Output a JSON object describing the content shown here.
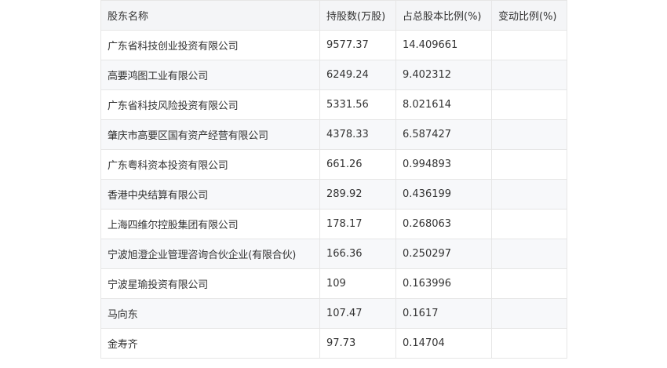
{
  "table": {
    "headers": [
      "股东名称",
      "持股数(万股)",
      "占总股本比例(%)",
      "变动比例(%)"
    ],
    "rows": [
      {
        "name": "广东省科技创业投资有限公司",
        "shares": "9577.37",
        "ratio": "14.409661",
        "change": ""
      },
      {
        "name": "高要鸿图工业有限公司",
        "shares": "6249.24",
        "ratio": "9.402312",
        "change": ""
      },
      {
        "name": "广东省科技风险投资有限公司",
        "shares": "5331.56",
        "ratio": "8.021614",
        "change": ""
      },
      {
        "name": "肇庆市高要区国有资产经营有限公司",
        "shares": "4378.33",
        "ratio": "6.587427",
        "change": ""
      },
      {
        "name": "广东粤科资本投资有限公司",
        "shares": "661.26",
        "ratio": "0.994893",
        "change": ""
      },
      {
        "name": "香港中央结算有限公司",
        "shares": "289.92",
        "ratio": "0.436199",
        "change": ""
      },
      {
        "name": "上海四维尔控股集团有限公司",
        "shares": "178.17",
        "ratio": "0.268063",
        "change": ""
      },
      {
        "name": "宁波旭澄企业管理咨询合伙企业(有限合伙)",
        "shares": "166.36",
        "ratio": "0.250297",
        "change": ""
      },
      {
        "name": "宁波星瑜投资有限公司",
        "shares": "109",
        "ratio": "0.163996",
        "change": ""
      },
      {
        "name": "马向东",
        "shares": "107.47",
        "ratio": "0.1617",
        "change": ""
      },
      {
        "name": "金寿齐",
        "shares": "97.73",
        "ratio": "0.14704",
        "change": ""
      }
    ]
  }
}
